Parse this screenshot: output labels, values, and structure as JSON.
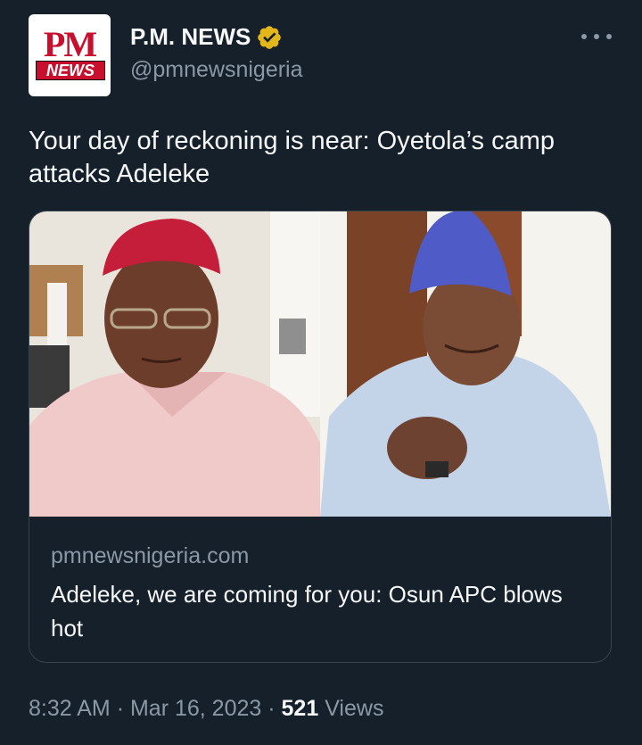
{
  "account": {
    "logo_text_top": "PM",
    "logo_text_bottom": "NEWS",
    "display_name": "P.M. NEWS",
    "handle": "@pmnewsnigeria",
    "verified_icon": "gold-verified-badge",
    "verified_color": "#e2b719"
  },
  "tweet": {
    "text": "Your day of reckoning is near: Oyetola’s camp attacks Adeleke"
  },
  "card": {
    "domain": "pmnewsnigeria.com",
    "title": "Adeleke, we are coming for you: Osun APC blows hot"
  },
  "meta": {
    "time": "8:32 AM",
    "separator": "·",
    "date": "Mar 16, 2023",
    "views_count": "521",
    "views_label": "Views"
  },
  "colors": {
    "background": "#15202b",
    "text_primary": "#f7f9f9",
    "text_secondary": "#8b98a5",
    "border": "#38444d"
  }
}
